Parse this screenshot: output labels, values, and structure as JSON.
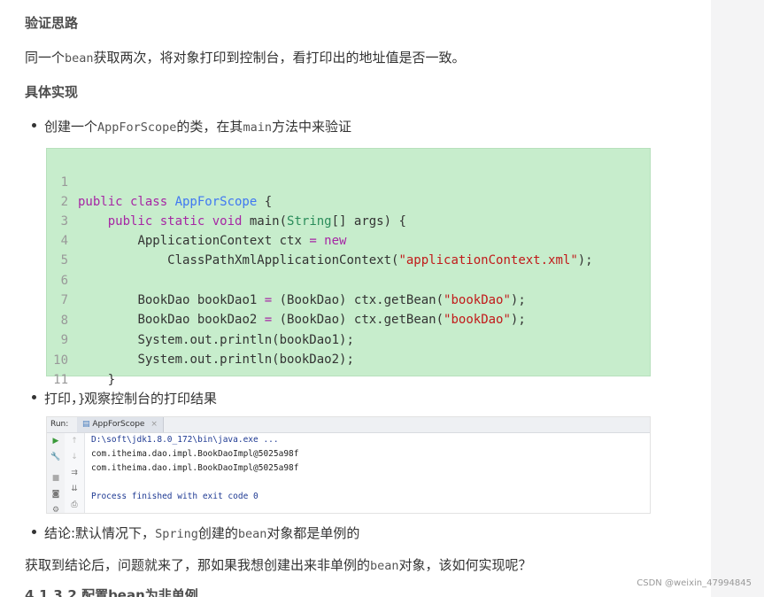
{
  "heading1": "验证思路",
  "para1": {
    "before": "同一个",
    "code": "bean",
    "after": "获取两次，将对象打印到控制台，看打印出的地址值是否一致。"
  },
  "heading2": "具体实现",
  "bullet1": {
    "before": "创建一个",
    "code1": "AppForScope",
    "mid": "的类，在其",
    "code2": "main",
    "after": "方法中来验证"
  },
  "code": {
    "line_numbers": [
      "1",
      "2",
      "3",
      "4",
      "5",
      "6",
      "7",
      "8",
      "9",
      "10",
      "11"
    ],
    "l1": {
      "kw": "public class ",
      "cls": "AppForScope",
      "rest": " {"
    },
    "l2": {
      "indent": "    ",
      "kw": "public static ",
      "ty": "void",
      "fn": " main(",
      "ty2": "String",
      "rest": "[] args) {"
    },
    "l3": {
      "indent": "        ",
      "plain": "ApplicationContext ctx ",
      "op": "= ",
      "kw": "new"
    },
    "l4": {
      "indent": "            ",
      "plain": "ClassPathXmlApplicationContext(",
      "str": "\"applicationContext.xml\"",
      "rest": ");"
    },
    "l5": "",
    "l6": {
      "indent": "        ",
      "plain": "BookDao bookDao1 ",
      "op": "=",
      "mid": " (BookDao) ctx.getBean(",
      "str": "\"bookDao\"",
      "rest": ");"
    },
    "l7": {
      "indent": "        ",
      "plain": "BookDao bookDao2 ",
      "op": "=",
      "mid": " (BookDao) ctx.getBean(",
      "str": "\"bookDao\"",
      "rest": ");"
    },
    "l8": {
      "indent": "        ",
      "plain": "System.out.println(bookDao1);"
    },
    "l9": {
      "indent": "        ",
      "plain": "System.out.println(bookDao2);"
    },
    "l10": {
      "indent": "    ",
      "plain": "}"
    },
    "l11": {
      "indent": "",
      "plain": "}"
    }
  },
  "bullet2": "打印，观察控制台的打印结果",
  "console": {
    "run_label": "Run:",
    "tab_label": "AppForScope",
    "tab_close": "×",
    "lines": [
      "D:\\soft\\jdk1.8.0_172\\bin\\java.exe ...",
      "com.itheima.dao.impl.BookDaoImpl@5025a98f",
      "com.itheima.dao.impl.BookDaoImpl@5025a98f",
      "",
      "Process finished with exit code 0"
    ]
  },
  "bullet3": {
    "before": "结论:默认情况下，",
    "code1": "Spring",
    "mid": "创建的",
    "code2": "bean",
    "after": "对象都是单例的"
  },
  "para2": {
    "before": "获取到结论后，问题就来了，那如果我想创建出来非单例的",
    "code": "bean",
    "after": "对象，该如何实现呢？"
  },
  "next_heading": "4.1.3.2 配置bean为非单例",
  "watermark": "CSDN @weixin_47994845",
  "colors": {
    "code_bg": "#c7edcc",
    "keyword": "#a626a4",
    "type": "#4078f2",
    "string": "#c11a1a"
  }
}
